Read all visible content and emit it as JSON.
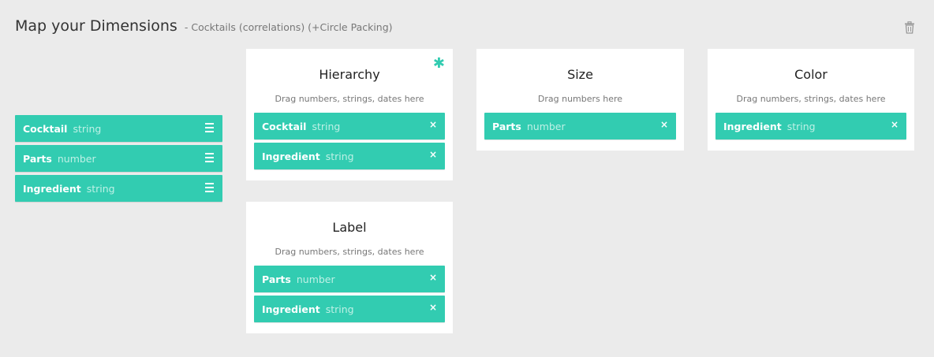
{
  "header": {
    "title": "Map your Dimensions",
    "subtitle": "- Cocktails (correlations) (+Circle Packing)"
  },
  "icons": {
    "trash": "trash-icon",
    "drag_handle": "hamburger-icon",
    "remove": "close-icon",
    "required": "asterisk-icon"
  },
  "colors": {
    "accent": "#32ccb1",
    "background": "#ebebeb",
    "card": "#ffffff"
  },
  "dimensions": [
    {
      "name": "Cocktail",
      "type": "string"
    },
    {
      "name": "Parts",
      "type": "number"
    },
    {
      "name": "Ingredient",
      "type": "string"
    }
  ],
  "remove_glyph": "×",
  "required_glyph": "✱",
  "cards": {
    "hierarchy": {
      "label": "Hierarchy",
      "hint": "Drag numbers, strings, dates here",
      "items": [
        {
          "name": "Cocktail",
          "type": "string"
        },
        {
          "name": "Ingredient",
          "type": "string"
        }
      ]
    },
    "size": {
      "label": "Size",
      "hint": "Drag numbers here",
      "items": [
        {
          "name": "Parts",
          "type": "number"
        }
      ]
    },
    "color": {
      "label": "Color",
      "hint": "Drag numbers, strings, dates here",
      "items": [
        {
          "name": "Ingredient",
          "type": "string"
        }
      ]
    },
    "label": {
      "label": "Label",
      "hint": "Drag numbers, strings, dates here",
      "items": [
        {
          "name": "Parts",
          "type": "number"
        },
        {
          "name": "Ingredient",
          "type": "string"
        }
      ]
    }
  }
}
